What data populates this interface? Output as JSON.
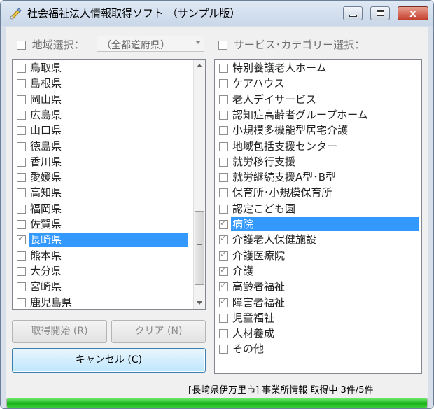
{
  "window": {
    "title": "社会福祉法人情報取得ソフト （サンプル版）",
    "close_glyph": "x"
  },
  "region": {
    "label": "地域選択：",
    "combo_value": "（全都道府県）"
  },
  "service": {
    "label": "サービス･カテゴリー選択："
  },
  "prefectures": [
    {
      "label": "鳥取県",
      "checked": false,
      "selected": false
    },
    {
      "label": "島根県",
      "checked": false,
      "selected": false
    },
    {
      "label": "岡山県",
      "checked": false,
      "selected": false
    },
    {
      "label": "広島県",
      "checked": false,
      "selected": false
    },
    {
      "label": "山口県",
      "checked": false,
      "selected": false
    },
    {
      "label": "徳島県",
      "checked": false,
      "selected": false
    },
    {
      "label": "香川県",
      "checked": false,
      "selected": false
    },
    {
      "label": "愛媛県",
      "checked": false,
      "selected": false
    },
    {
      "label": "高知県",
      "checked": false,
      "selected": false
    },
    {
      "label": "福岡県",
      "checked": false,
      "selected": false
    },
    {
      "label": "佐賀県",
      "checked": false,
      "selected": false
    },
    {
      "label": "長崎県",
      "checked": true,
      "selected": true
    },
    {
      "label": "熊本県",
      "checked": false,
      "selected": false
    },
    {
      "label": "大分県",
      "checked": false,
      "selected": false
    },
    {
      "label": "宮崎県",
      "checked": false,
      "selected": false
    },
    {
      "label": "鹿児島県",
      "checked": false,
      "selected": false
    }
  ],
  "services": [
    {
      "label": "特別養護老人ホーム",
      "checked": false,
      "selected": false
    },
    {
      "label": "ケアハウス",
      "checked": false,
      "selected": false
    },
    {
      "label": "老人デイサービス",
      "checked": false,
      "selected": false
    },
    {
      "label": "認知症高齢者グループホーム",
      "checked": false,
      "selected": false
    },
    {
      "label": "小規模多機能型居宅介護",
      "checked": false,
      "selected": false
    },
    {
      "label": "地域包括支援センター",
      "checked": false,
      "selected": false
    },
    {
      "label": "就労移行支援",
      "checked": false,
      "selected": false
    },
    {
      "label": "就労継続支援A型･B型",
      "checked": false,
      "selected": false
    },
    {
      "label": "保育所･小規模保育所",
      "checked": false,
      "selected": false
    },
    {
      "label": "認定こども園",
      "checked": false,
      "selected": false
    },
    {
      "label": "病院",
      "checked": true,
      "selected": true
    },
    {
      "label": "介護老人保健施設",
      "checked": true,
      "selected": false
    },
    {
      "label": "介護医療院",
      "checked": true,
      "selected": false
    },
    {
      "label": "介護",
      "checked": true,
      "selected": false
    },
    {
      "label": "高齢者福祉",
      "checked": true,
      "selected": false
    },
    {
      "label": "障害者福祉",
      "checked": true,
      "selected": false
    },
    {
      "label": "児童福祉",
      "checked": false,
      "selected": false
    },
    {
      "label": "人材養成",
      "checked": false,
      "selected": false
    },
    {
      "label": "その他",
      "checked": false,
      "selected": false
    }
  ],
  "buttons": {
    "start": "取得開始 (R)",
    "clear": "クリア (N)",
    "cancel": "キャンセル (C)"
  },
  "status": "[長崎県伊万里市] 事業所情報 取得中 3件/5件",
  "progress": {
    "fraction": 1.0
  }
}
